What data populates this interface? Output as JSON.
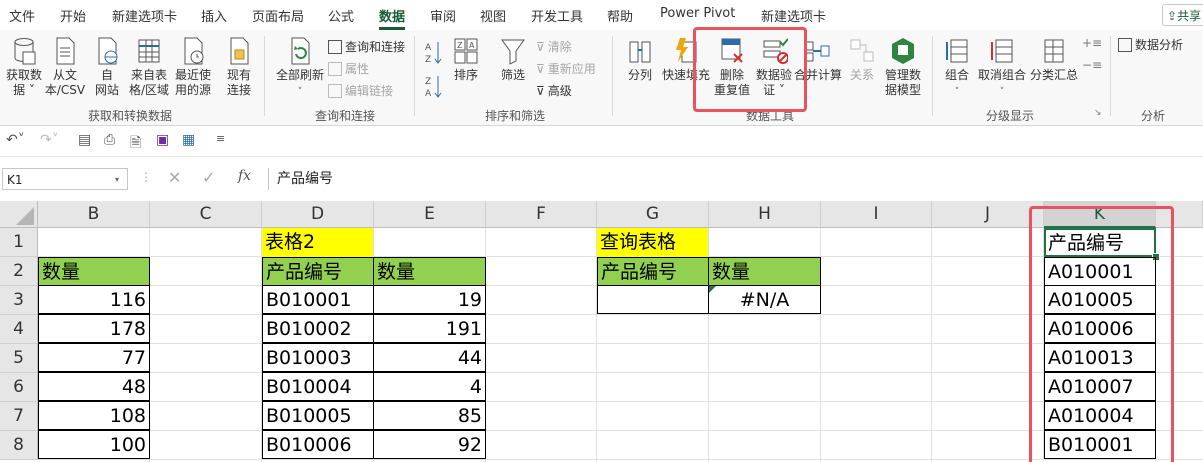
{
  "menu_tabs": [
    "文件",
    "开始",
    "新建选项卡",
    "插入",
    "页面布局",
    "公式",
    "数据",
    "审阅",
    "视图",
    "开发工具",
    "帮助",
    "Power Pivot",
    "新建选项卡"
  ],
  "share_label": "共享",
  "ribbon": {
    "get_data": {
      "buttons": [
        "获取数\n据 ˅",
        "从文\n本/CSV",
        "自\n网站",
        "来自表\n格/区域",
        "最近使\n用的源",
        "现有\n连接"
      ],
      "label": "获取和转换数据"
    },
    "queries": {
      "refresh_all": "全部刷新",
      "items": [
        "查询和连接",
        "属性",
        "编辑链接"
      ],
      "label": "查询和连接"
    },
    "sort_filter": {
      "sort": "排序",
      "filter": "筛选",
      "items": [
        "清除",
        "重新应用",
        "高级"
      ],
      "label": "排序和筛选"
    },
    "data_tools": {
      "buttons": [
        "分列",
        "快速填充",
        "删除\n重复值",
        "数据验\n证 ˅",
        "合并计算",
        "关系",
        "管理数\n据模型"
      ],
      "label": "数据工具"
    },
    "outline": {
      "buttons": [
        "组合",
        "取消组合",
        "分类汇总"
      ],
      "label": "分级显示"
    },
    "analysis": {
      "button": "数据分析",
      "label": "分析"
    }
  },
  "name_box": "K1",
  "fx_label": "fx",
  "formula": "产品编号",
  "columns": [
    "B",
    "C",
    "D",
    "E",
    "F",
    "G",
    "H",
    "I",
    "J",
    "K"
  ],
  "rows": [
    "1",
    "2",
    "3",
    "4",
    "5",
    "6",
    "7",
    "8"
  ],
  "table_b": {
    "header": "数量",
    "values": [
      "116",
      "178",
      "77",
      "48",
      "108",
      "100"
    ]
  },
  "table2": {
    "title": "表格2",
    "headers": [
      "产品编号",
      "数量"
    ],
    "rows": [
      [
        "B010001",
        "19"
      ],
      [
        "B010002",
        "191"
      ],
      [
        "B010003",
        "44"
      ],
      [
        "B010004",
        "4"
      ],
      [
        "B010005",
        "85"
      ],
      [
        "B010006",
        "92"
      ]
    ]
  },
  "query_table": {
    "title": "查询表格",
    "headers": [
      "产品编号",
      "数量"
    ],
    "result": [
      "",
      "#N/A"
    ]
  },
  "k_column": {
    "header": "产品编号",
    "values": [
      "A010001",
      "A010005",
      "A010006",
      "A010013",
      "A010007",
      "A010004",
      "B010001"
    ]
  },
  "colors": {
    "accent": "#217346",
    "header_green": "#92d050",
    "header_yellow": "#ffff00",
    "highlight_red": "#e8535f"
  }
}
